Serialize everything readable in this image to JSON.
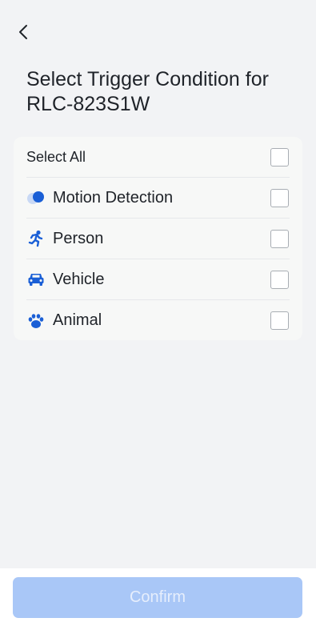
{
  "header": {
    "back_icon": "chevron-left-icon",
    "title": "Select Trigger Condition for RLC-823S1W"
  },
  "conditions": {
    "select_all": {
      "label": "Select All",
      "checked": false
    },
    "items": [
      {
        "label": "Motion Detection",
        "icon": "motion-icon",
        "checked": false
      },
      {
        "label": "Person",
        "icon": "person-running-icon",
        "checked": false
      },
      {
        "label": "Vehicle",
        "icon": "car-icon",
        "checked": false
      },
      {
        "label": "Animal",
        "icon": "paw-icon",
        "checked": false
      }
    ]
  },
  "footer": {
    "confirm_label": "Confirm",
    "confirm_enabled": false
  },
  "colors": {
    "accent": "#1a5fd6",
    "background": "#f2f3f5",
    "confirm_disabled": "#a9c7f7"
  }
}
